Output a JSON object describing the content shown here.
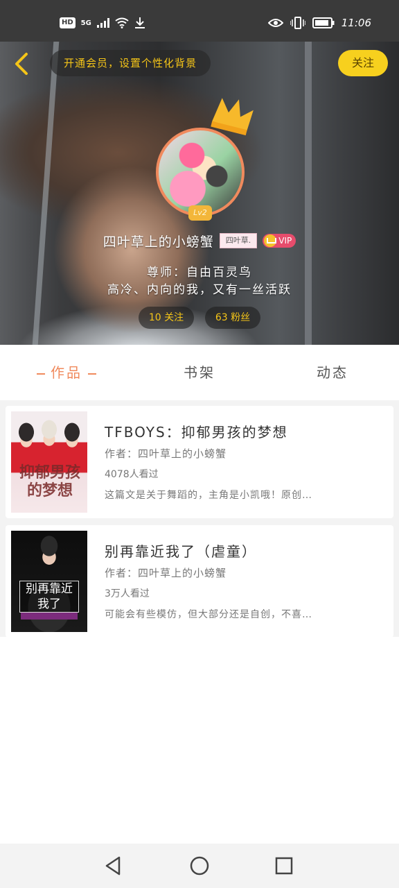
{
  "status_bar": {
    "hd": "HD",
    "network": "5G",
    "time": "11:06",
    "icons": [
      "signal-icon",
      "wifi-icon",
      "download-icon",
      "eye-icon",
      "vibrate-icon",
      "battery-icon"
    ]
  },
  "header": {
    "vip_banner": "开通会员，设置个性化背景",
    "follow_label": "关注",
    "level": "Lv2",
    "nickname": "四叶草上的小螃蟹",
    "name_tag": "四叶草.",
    "vip_label": "VIP",
    "mentor": "尊师：自由百灵鸟",
    "bio": "高冷、内向的我，又有一丝活跃",
    "following": "10 关注",
    "fans": "63 粉丝",
    "colors": {
      "accent": "#f08a5d",
      "gold": "#f5c518",
      "follow_bg": "#f7d01e"
    }
  },
  "tabs": [
    {
      "label": "作品",
      "active": true
    },
    {
      "label": "书架",
      "active": false
    },
    {
      "label": "动态",
      "active": false
    }
  ],
  "works": [
    {
      "title": "TFBOYS：抑郁男孩的梦想",
      "author": "作者：四叶草上的小螃蟹",
      "views": "4078人看过",
      "desc": "这篇文是关于舞蹈的，主角是小凯哦！原创…",
      "cover_text": "抑郁男孩的梦想"
    },
    {
      "title": "别再靠近我了（虐童）",
      "author": "作者：四叶草上的小螃蟹",
      "views": "3万人看过",
      "desc": "可能会有些模仿，但大部分还是自创，不喜…",
      "cover_text": "别再靠近我了"
    }
  ]
}
